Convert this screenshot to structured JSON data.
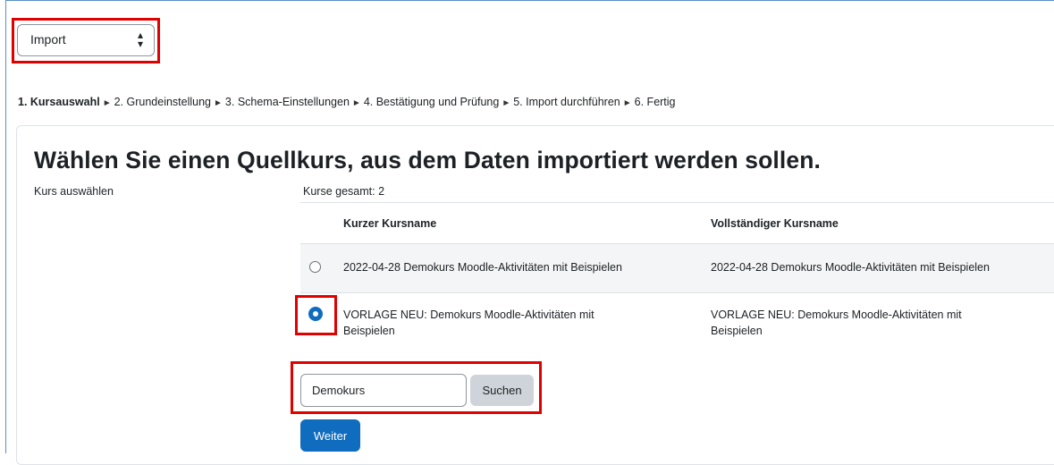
{
  "import_select": {
    "value": "Import",
    "icon": "sort-arrows-icon"
  },
  "steps": [
    {
      "label": "1. Kursauswahl",
      "active": true
    },
    {
      "label": "2. Grundeinstellung",
      "active": false
    },
    {
      "label": "3. Schema-Einstellungen",
      "active": false
    },
    {
      "label": "4. Bestätigung und Prüfung",
      "active": false
    },
    {
      "label": "5. Import durchführen",
      "active": false
    },
    {
      "label": "6. Fertig",
      "active": false
    }
  ],
  "step_separator": "►",
  "heading": "Wählen Sie einen Quellkurs, aus dem Daten importiert werden sollen.",
  "course_select_label": "Kurs auswählen",
  "total_courses": "Kurse gesamt: 2",
  "table": {
    "headers": [
      "Kurzer Kursname",
      "Vollständiger Kursname"
    ],
    "rows": [
      {
        "selected": false,
        "short_name": "2022-04-28 Demokurs Moodle-Aktivitäten mit Beispielen",
        "full_name": "2022-04-28 Demokurs Moodle-Aktivitäten mit Beispielen"
      },
      {
        "selected": true,
        "short_name_line1": "VORLAGE NEU: Demokurs Moodle-Aktivitäten mit",
        "short_name_line2": "Beispielen",
        "full_name_line1": "VORLAGE NEU: Demokurs Moodle-Aktivitäten mit",
        "full_name_line2": "Beispielen"
      }
    ]
  },
  "search": {
    "value": "Demokurs",
    "button_label": "Suchen"
  },
  "continue_label": "Weiter",
  "colors": {
    "primary": "#0f6cbf",
    "highlight": "#e00000",
    "secondary_button": "#ced4da"
  }
}
